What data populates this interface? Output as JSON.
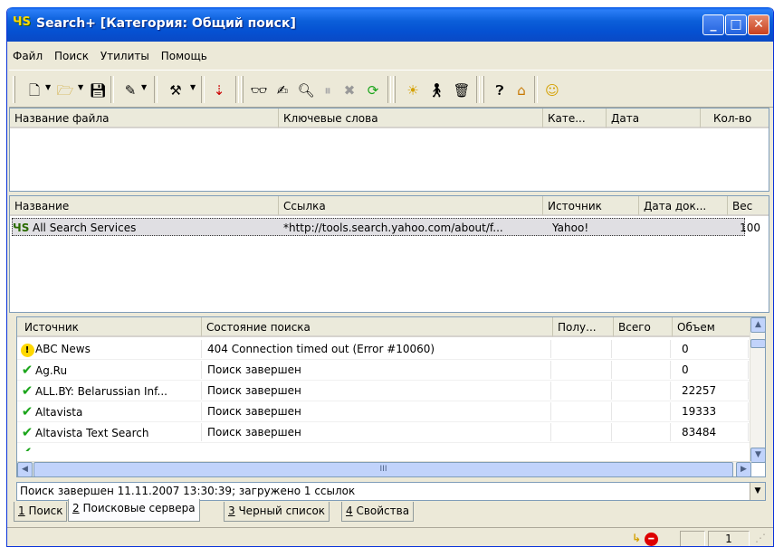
{
  "window": {
    "icon": "app-search-icon",
    "title": "Search+ [Категория: Общий поиск]",
    "minimize": "_",
    "maximize": "□",
    "close": "✕"
  },
  "menu": [
    "Файл",
    "Поиск",
    "Утилиты",
    "Помощь"
  ],
  "files_table": {
    "columns": [
      "Название файла",
      "Ключевые слова",
      "Кате...",
      "Дата",
      "Кол-во"
    ]
  },
  "results_table": {
    "columns": [
      "Название",
      "Ссылка",
      "Источник",
      "Дата док...",
      "Вес"
    ],
    "rows": [
      {
        "name": "All Search Services",
        "link": "*http://tools.search.yahoo.com/about/f...",
        "source": "Yahoo!",
        "date": "",
        "weight": "100"
      }
    ]
  },
  "sources_table": {
    "columns": [
      "Источник",
      "Состояние поиска",
      "Полу...",
      "Всего",
      "Объем"
    ],
    "rows": [
      {
        "icon": "warning",
        "source": "ABC News",
        "status": "404 Connection timed out (Error #10060)",
        "got": "",
        "total": "",
        "size": "0"
      },
      {
        "icon": "check",
        "source": "Ag.Ru",
        "status": "Поиск завершен",
        "got": "",
        "total": "",
        "size": "0"
      },
      {
        "icon": "check",
        "source": "ALL.BY: Belarussian Inf...",
        "status": "Поиск завершен",
        "got": "",
        "total": "",
        "size": "22257"
      },
      {
        "icon": "check",
        "source": "Altavista",
        "status": "Поиск завершен",
        "got": "",
        "total": "",
        "size": "19333"
      },
      {
        "icon": "check",
        "source": "Altavista Text Search",
        "status": "Поиск завершен",
        "got": "",
        "total": "",
        "size": "83484"
      }
    ],
    "hscroll_thumb": "III"
  },
  "log": {
    "text": "Поиск завершен 11.11.2007 13:30:39; загружено 1 ссылок"
  },
  "tabs": [
    {
      "num": "1",
      "label": " Поиск"
    },
    {
      "num": "2",
      "label": " Поисковые сервера"
    },
    {
      "num": "3",
      "label": " Черный список"
    },
    {
      "num": "4",
      "label": " Свойства"
    }
  ],
  "statusbar": {
    "page": "1"
  }
}
